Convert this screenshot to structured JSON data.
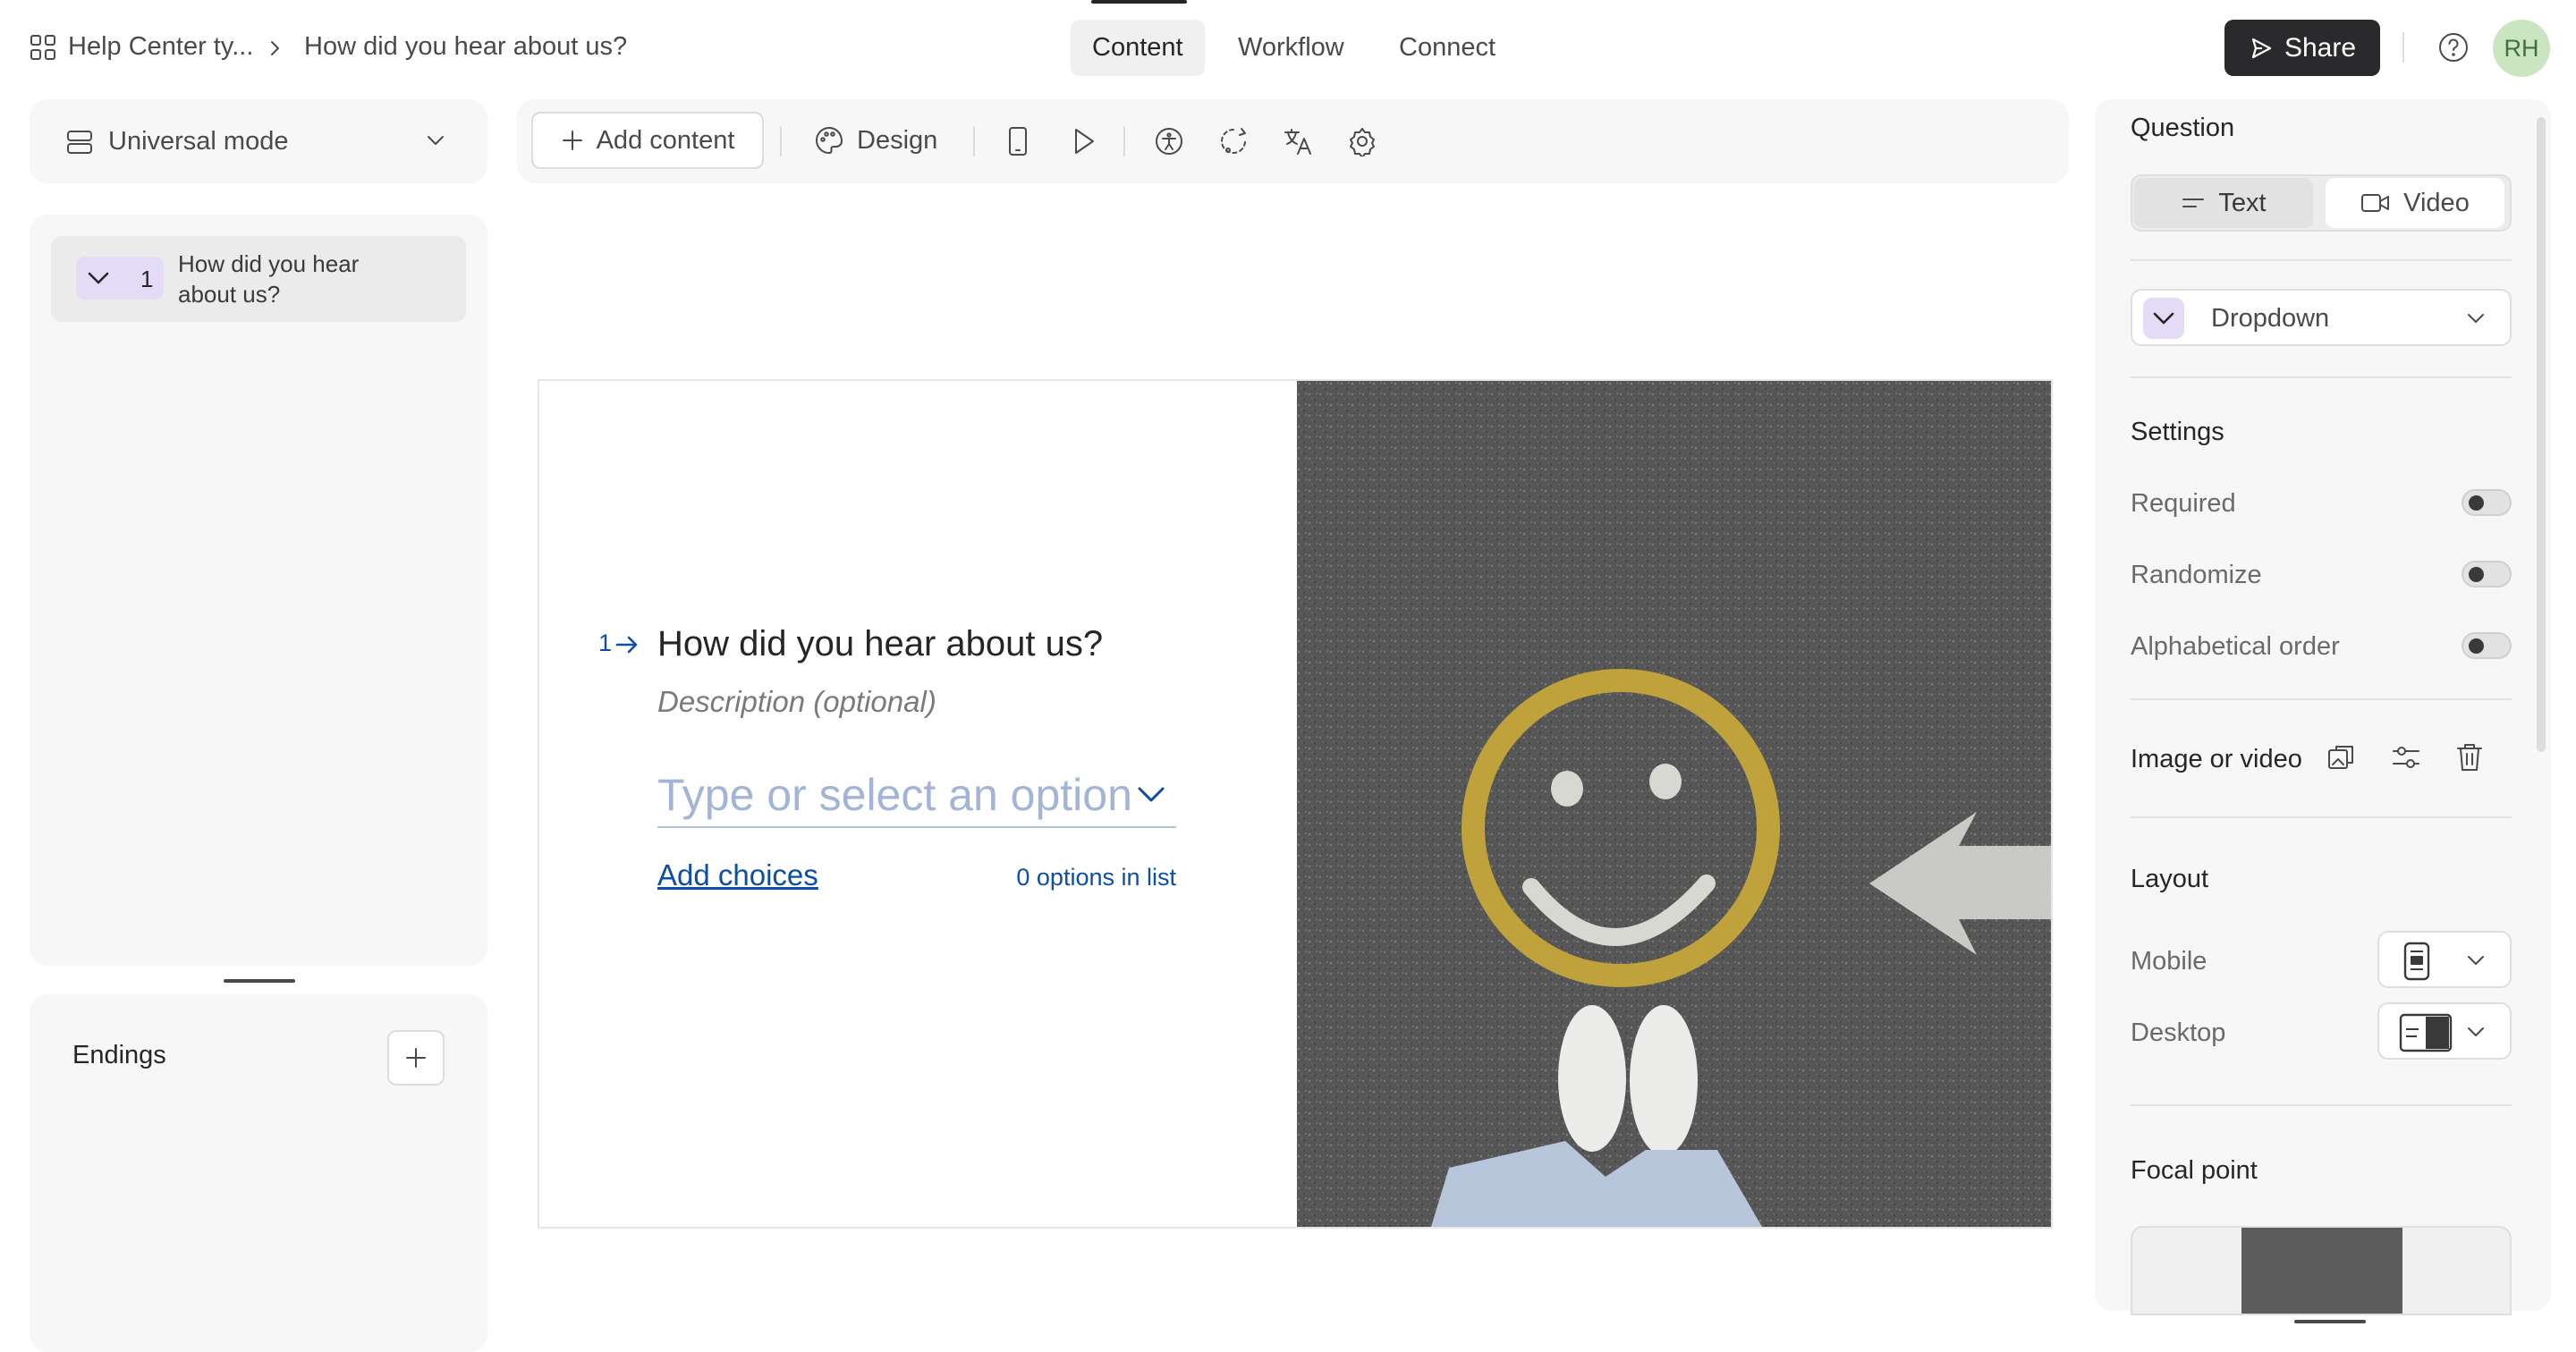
{
  "breadcrumb": {
    "workspace": "Help Center ty...",
    "form": "How did you hear about us?"
  },
  "nav": {
    "tabs": [
      "Content",
      "Workflow",
      "Connect"
    ],
    "active": "Content"
  },
  "header": {
    "share_label": "Share",
    "avatar_initials": "RH"
  },
  "mode": {
    "label": "Universal mode"
  },
  "questions": [
    {
      "number": "1",
      "title": "How did you hear about us?"
    }
  ],
  "endings": {
    "label": "Endings"
  },
  "toolbar": {
    "add_content": "Add content",
    "design": "Design"
  },
  "canvas": {
    "question_number": "1",
    "question_title": "How did you hear about us?",
    "description_placeholder": "Description (optional)",
    "dropdown_placeholder": "Type or select an option",
    "add_choices": "Add choices",
    "options_count": "0 options in list"
  },
  "right_panel": {
    "question_heading": "Question",
    "type_text": "Text",
    "type_video": "Video",
    "question_type": "Dropdown",
    "settings_heading": "Settings",
    "settings": [
      {
        "label": "Required",
        "on": false
      },
      {
        "label": "Randomize",
        "on": false
      },
      {
        "label": "Alphabetical order",
        "on": false
      }
    ],
    "image_or_video": "Image or video",
    "layout_heading": "Layout",
    "layout_mobile": "Mobile",
    "layout_desktop": "Desktop",
    "focal_point": "Focal point"
  },
  "colors": {
    "primary_dark": "#2a2a2c",
    "accent_purple": "#e4dcf7",
    "link_blue": "#0d4ea6",
    "placeholder_blue": "#a3b4d6",
    "avatar_green": "#c9e6c1"
  }
}
